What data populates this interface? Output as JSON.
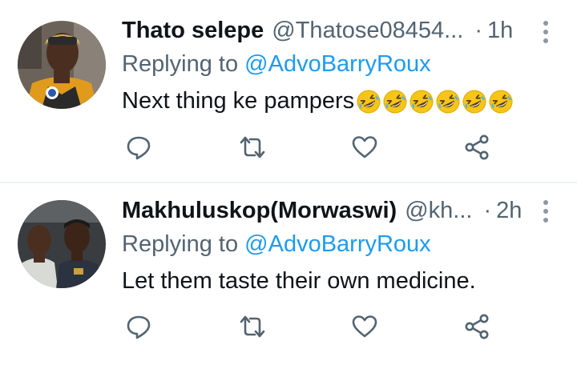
{
  "tweets": [
    {
      "name": "Thato selepe",
      "handle": "@Thatose08454...",
      "separator": "·",
      "time": "1h",
      "replying_prefix": "Replying to ",
      "replying_to": "@AdvoBarryRoux",
      "text": "Next thing ke pampers",
      "emoji_icon": "rolling-on-floor-laughing-emoji",
      "emoji_count": 6
    },
    {
      "name": "Makhuluskop(Morwaswi)",
      "handle": "@kh...",
      "separator": "·",
      "time": "2h",
      "replying_prefix": "Replying to ",
      "replying_to": "@AdvoBarryRoux",
      "text": "Let them taste their own medicine."
    }
  ],
  "icons": {
    "reply": "comment-icon",
    "retweet": "retweet-icon",
    "like": "heart-icon",
    "share": "share-icon",
    "more": "more-vertical-icon"
  },
  "colors": {
    "text": "#0f1419",
    "secondary": "#536471",
    "link": "#1d9bf0",
    "divider": "#eff3f4"
  }
}
